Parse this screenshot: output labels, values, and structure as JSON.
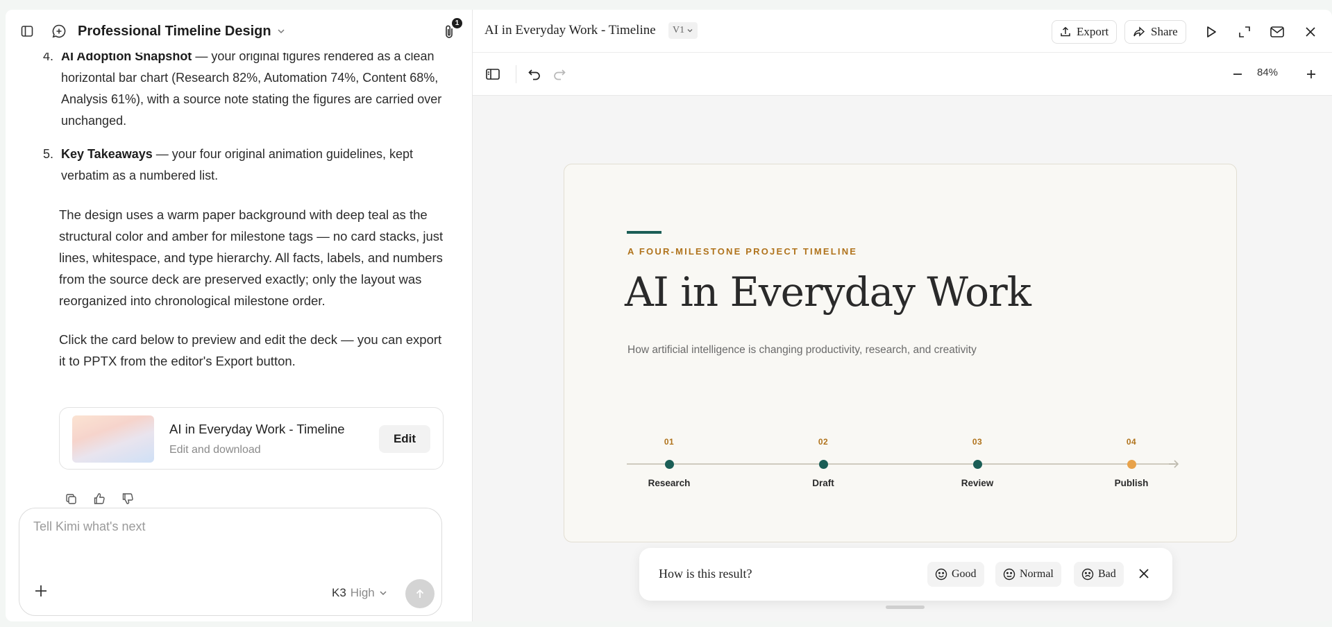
{
  "chat": {
    "title": "Professional Timeline Design",
    "attachment_count": "1",
    "list": [
      {
        "num": "4.",
        "heading": "AI Adoption Snapshot",
        "text": " — your original figures rendered as a clean horizontal bar chart (Research 82%, Automation 74%, Content 68%, Analysis 61%), with a source note stating the figures are carried over unchanged."
      },
      {
        "num": "5.",
        "heading": "Key Takeaways",
        "text": " — your four original animation guidelines, kept verbatim as a numbered list."
      }
    ],
    "paragraph1": "The design uses a warm paper background with deep teal as the structural color and amber for milestone tags — no card stacks, just lines, whitespace, and type hierarchy. All facts, labels, and numbers from the source deck are preserved exactly; only the layout was reorganized into chronological milestone order.",
    "paragraph2": "Click the card below to preview and edit the deck — you can export it to PPTX from the editor's Export button.",
    "card": {
      "title": "AI in Everyday Work - Timeline",
      "subtitle": "Edit and download",
      "edit_label": "Edit"
    },
    "composer": {
      "placeholder": "Tell Kimi what's next",
      "model": "K3",
      "level": "High"
    }
  },
  "editor": {
    "doc_title": "AI in Everyday Work - Timeline",
    "version": "V1",
    "export_label": "Export",
    "share_label": "Share",
    "zoom": "84%"
  },
  "slide": {
    "kicker": "A FOUR-MILESTONE PROJECT TIMELINE",
    "title": "AI in Everyday Work",
    "subtitle": "How artificial intelligence is changing productivity, research, and creativity",
    "milestones": [
      {
        "num": "01",
        "label": "Research",
        "color": "#1b5e56"
      },
      {
        "num": "02",
        "label": "Draft",
        "color": "#1b5e56"
      },
      {
        "num": "03",
        "label": "Review",
        "color": "#1b5e56"
      },
      {
        "num": "04",
        "label": "Publish",
        "color": "#e8a24a"
      }
    ]
  },
  "feedback": {
    "question": "How is this result?",
    "good": "Good",
    "normal": "Normal",
    "bad": "Bad"
  }
}
